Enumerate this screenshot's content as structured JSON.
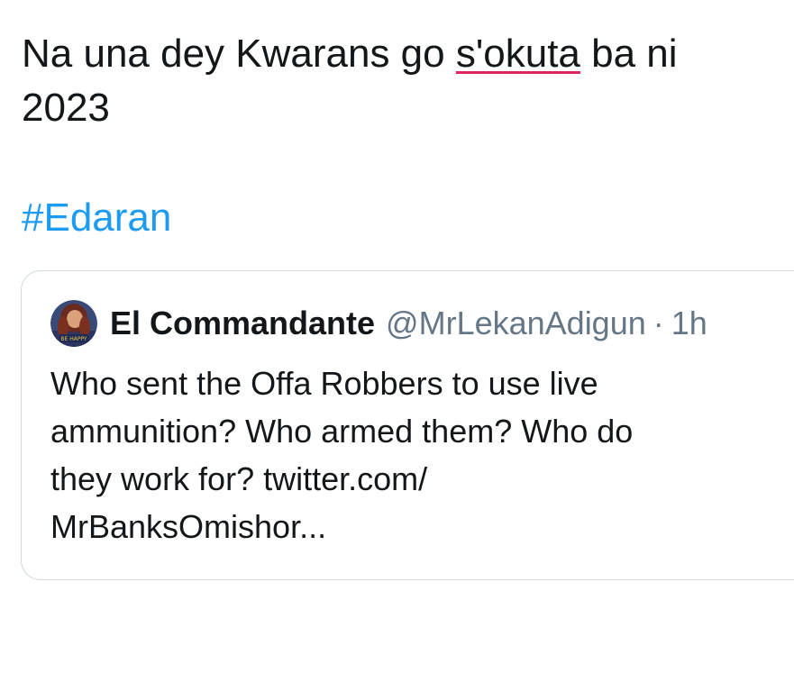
{
  "tweet": {
    "text_line1_before": "Na una dey Kwarans go ",
    "text_line1_word": "s'okuta",
    "text_line1_after": " ba ni",
    "text_line2": "2023",
    "hashtag": "#Edaran"
  },
  "quoted_tweet": {
    "author_name": "El Commandante",
    "author_handle": "@MrLekanAdigun",
    "separator": "·",
    "time": "1h",
    "avatar_caption": "BE HAPPY",
    "body_lines": [
      "Who sent the Offa Robbers to use live",
      "ammunition? Who armed them? Who do",
      "they work for? twitter.com/",
      "MrBanksOmishor..."
    ]
  },
  "colors": {
    "text": "#14171a",
    "link": "#1d9bf0",
    "muted": "#657786",
    "border": "#cfd9de",
    "spellcheck": "#e0245e"
  }
}
